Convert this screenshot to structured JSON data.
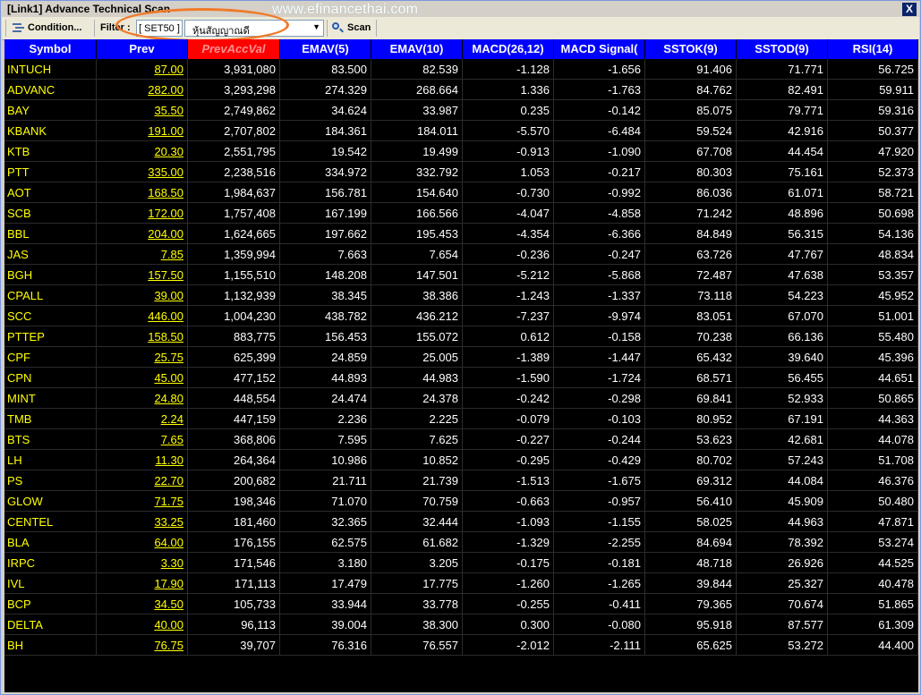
{
  "window": {
    "title": "[Link1] Advance Technical Scan",
    "close_glyph": "X"
  },
  "watermark": "www.efinancethai.com",
  "toolbar": {
    "condition_label": "Condition...",
    "filter_label": "Filter :",
    "filter_value": "[ SET50 ]",
    "select_value": "หุ้นสัญญาณดี",
    "scan_label": "Scan"
  },
  "columns": [
    "Symbol",
    "Prev",
    "PrevAccVal",
    "EMAV(5)",
    "EMAV(10)",
    "MACD(26,12)",
    "MACD Signal(",
    "SSTOK(9)",
    "SSTOD(9)",
    "RSI(14)"
  ],
  "rows": [
    [
      "INTUCH",
      "87.00",
      "3,931,080",
      "83.500",
      "82.539",
      "-1.128",
      "-1.656",
      "91.406",
      "71.771",
      "56.725"
    ],
    [
      "ADVANC",
      "282.00",
      "3,293,298",
      "274.329",
      "268.664",
      "1.336",
      "-1.763",
      "84.762",
      "82.491",
      "59.911"
    ],
    [
      "BAY",
      "35.50",
      "2,749,862",
      "34.624",
      "33.987",
      "0.235",
      "-0.142",
      "85.075",
      "79.771",
      "59.316"
    ],
    [
      "KBANK",
      "191.00",
      "2,707,802",
      "184.361",
      "184.011",
      "-5.570",
      "-6.484",
      "59.524",
      "42.916",
      "50.377"
    ],
    [
      "KTB",
      "20.30",
      "2,551,795",
      "19.542",
      "19.499",
      "-0.913",
      "-1.090",
      "67.708",
      "44.454",
      "47.920"
    ],
    [
      "PTT",
      "335.00",
      "2,238,516",
      "334.972",
      "332.792",
      "1.053",
      "-0.217",
      "80.303",
      "75.161",
      "52.373"
    ],
    [
      "AOT",
      "168.50",
      "1,984,637",
      "156.781",
      "154.640",
      "-0.730",
      "-0.992",
      "86.036",
      "61.071",
      "58.721"
    ],
    [
      "SCB",
      "172.00",
      "1,757,408",
      "167.199",
      "166.566",
      "-4.047",
      "-4.858",
      "71.242",
      "48.896",
      "50.698"
    ],
    [
      "BBL",
      "204.00",
      "1,624,665",
      "197.662",
      "195.453",
      "-4.354",
      "-6.366",
      "84.849",
      "56.315",
      "54.136"
    ],
    [
      "JAS",
      "7.85",
      "1,359,994",
      "7.663",
      "7.654",
      "-0.236",
      "-0.247",
      "63.726",
      "47.767",
      "48.834"
    ],
    [
      "BGH",
      "157.50",
      "1,155,510",
      "148.208",
      "147.501",
      "-5.212",
      "-5.868",
      "72.487",
      "47.638",
      "53.357"
    ],
    [
      "CPALL",
      "39.00",
      "1,132,939",
      "38.345",
      "38.386",
      "-1.243",
      "-1.337",
      "73.118",
      "54.223",
      "45.952"
    ],
    [
      "SCC",
      "446.00",
      "1,004,230",
      "438.782",
      "436.212",
      "-7.237",
      "-9.974",
      "83.051",
      "67.070",
      "51.001"
    ],
    [
      "PTTEP",
      "158.50",
      "883,775",
      "156.453",
      "155.072",
      "0.612",
      "-0.158",
      "70.238",
      "66.136",
      "55.480"
    ],
    [
      "CPF",
      "25.75",
      "625,399",
      "24.859",
      "25.005",
      "-1.389",
      "-1.447",
      "65.432",
      "39.640",
      "45.396"
    ],
    [
      "CPN",
      "45.00",
      "477,152",
      "44.893",
      "44.983",
      "-1.590",
      "-1.724",
      "68.571",
      "56.455",
      "44.651"
    ],
    [
      "MINT",
      "24.80",
      "448,554",
      "24.474",
      "24.378",
      "-0.242",
      "-0.298",
      "69.841",
      "52.933",
      "50.865"
    ],
    [
      "TMB",
      "2.24",
      "447,159",
      "2.236",
      "2.225",
      "-0.079",
      "-0.103",
      "80.952",
      "67.191",
      "44.363"
    ],
    [
      "BTS",
      "7.65",
      "368,806",
      "7.595",
      "7.625",
      "-0.227",
      "-0.244",
      "53.623",
      "42.681",
      "44.078"
    ],
    [
      "LH",
      "11.30",
      "264,364",
      "10.986",
      "10.852",
      "-0.295",
      "-0.429",
      "80.702",
      "57.243",
      "51.708"
    ],
    [
      "PS",
      "22.70",
      "200,682",
      "21.711",
      "21.739",
      "-1.513",
      "-1.675",
      "69.312",
      "44.084",
      "46.376"
    ],
    [
      "GLOW",
      "71.75",
      "198,346",
      "71.070",
      "70.759",
      "-0.663",
      "-0.957",
      "56.410",
      "45.909",
      "50.480"
    ],
    [
      "CENTEL",
      "33.25",
      "181,460",
      "32.365",
      "32.444",
      "-1.093",
      "-1.155",
      "58.025",
      "44.963",
      "47.871"
    ],
    [
      "BLA",
      "64.00",
      "176,155",
      "62.575",
      "61.682",
      "-1.329",
      "-2.255",
      "84.694",
      "78.392",
      "53.274"
    ],
    [
      "IRPC",
      "3.30",
      "171,546",
      "3.180",
      "3.205",
      "-0.175",
      "-0.181",
      "48.718",
      "26.926",
      "44.525"
    ],
    [
      "IVL",
      "17.90",
      "171,113",
      "17.479",
      "17.775",
      "-1.260",
      "-1.265",
      "39.844",
      "25.327",
      "40.478"
    ],
    [
      "BCP",
      "34.50",
      "105,733",
      "33.944",
      "33.778",
      "-0.255",
      "-0.411",
      "79.365",
      "70.674",
      "51.865"
    ],
    [
      "DELTA",
      "40.00",
      "96,113",
      "39.004",
      "38.300",
      "0.300",
      "-0.080",
      "95.918",
      "87.577",
      "61.309"
    ],
    [
      "BH",
      "76.75",
      "39,707",
      "76.316",
      "76.557",
      "-2.012",
      "-2.111",
      "65.625",
      "53.272",
      "44.400"
    ]
  ],
  "colors": {
    "header_bg": "#0000ff",
    "sorted_header_bg": "#ff0000",
    "grid_bg": "#000000",
    "symbol_text": "#ffff00",
    "value_text": "#ffffff",
    "highlight_oval": "#f07a2a"
  }
}
